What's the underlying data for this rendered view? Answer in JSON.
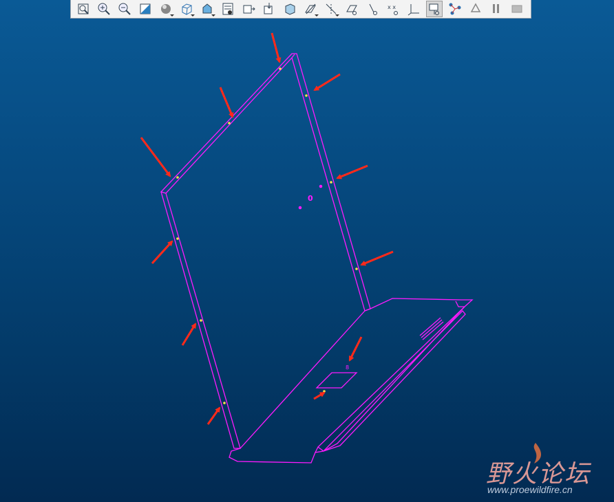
{
  "toolbar": {
    "buttons": [
      {
        "name": "refit-button",
        "icon": "refit-icon"
      },
      {
        "name": "zoom-in-button",
        "icon": "zoom-in-icon"
      },
      {
        "name": "zoom-out-button",
        "icon": "zoom-out-icon"
      },
      {
        "name": "repaint-button",
        "icon": "repaint-icon"
      },
      {
        "name": "display-style-button",
        "icon": "shaded-sphere-icon",
        "dropdown": true
      },
      {
        "name": "view-orientation-button",
        "icon": "wire-cube-icon",
        "dropdown": true
      },
      {
        "name": "saved-views-button",
        "icon": "saved-orientation-icon",
        "dropdown": true
      },
      {
        "name": "view-manager-button",
        "icon": "view-manager-icon"
      },
      {
        "name": "perspective-button",
        "icon": "perspective-icon"
      },
      {
        "name": "spin-center-button",
        "icon": "spin-center-icon"
      },
      {
        "name": "section-button",
        "icon": "section-cube-icon"
      },
      {
        "name": "datum-plane-display-button",
        "icon": "datum-plane-icon",
        "dropdown": true
      },
      {
        "name": "datum-axis-display-button",
        "icon": "datum-axis-icon",
        "dropdown": true
      },
      {
        "name": "plane-tag-display-button",
        "icon": "plane-tag-icon"
      },
      {
        "name": "axis-tag-display-button",
        "icon": "axis-tag-icon"
      },
      {
        "name": "point-tag-display-button",
        "icon": "point-tag-icon"
      },
      {
        "name": "csys-display-button",
        "icon": "csys-icon"
      },
      {
        "name": "annotation-display-button",
        "icon": "annotation-icon",
        "active": true
      },
      {
        "name": "regenerate-button",
        "icon": "regenerate-icon"
      },
      {
        "name": "recycle-button",
        "icon": "recycle-icon"
      },
      {
        "name": "pause-button",
        "icon": "pause-icon"
      },
      {
        "name": "stop-button",
        "icon": "stop-icon"
      }
    ]
  },
  "model": {
    "line_color": "#ff1aff",
    "arrow_color": "#ff2a1a",
    "point_color": "#ffe24a",
    "annotation_label": "0",
    "small_label": "8"
  },
  "watermark": {
    "title": "野火论坛",
    "url": "www.proewildfire.cn"
  },
  "colors": {
    "bg_top": "#0a5a96",
    "bg_bottom": "#022a52"
  }
}
